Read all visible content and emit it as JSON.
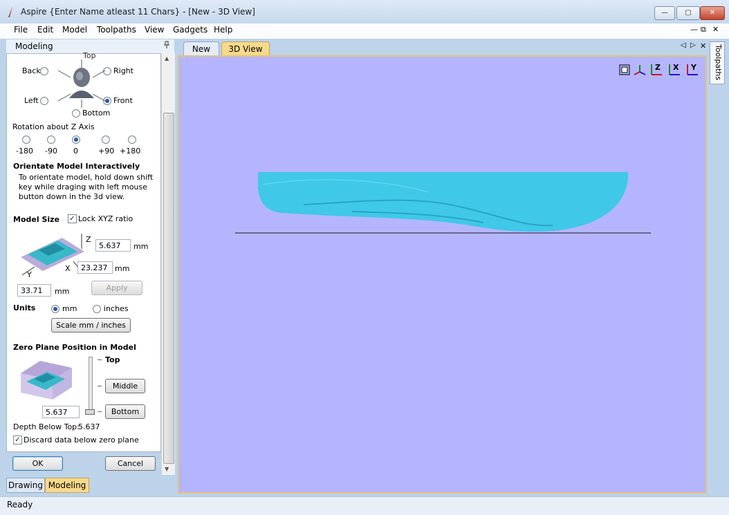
{
  "window": {
    "title": "Aspire {Enter Name atleast 11 Chars} - [New - 3D View]"
  },
  "window_controls": {
    "minimize": "—",
    "maximize": "▢",
    "close": "✕"
  },
  "mdi_controls": {
    "minimize": "—",
    "restore": "⧉",
    "close": "✕"
  },
  "menu": [
    "File",
    "Edit",
    "Model",
    "Toolpaths",
    "View",
    "Gadgets",
    "Help"
  ],
  "modeling_panel": {
    "title": "Modeling",
    "pin_icon": "pin-icon",
    "views": {
      "top": "Top",
      "back": "Back",
      "right": "Right",
      "left": "Left",
      "front": "Front",
      "bottom": "Bottom",
      "selected": "Front"
    },
    "rotation": {
      "label": "Rotation about Z Axis",
      "options": [
        "-180",
        "-90",
        "0",
        "+90",
        "+180"
      ],
      "selected": "0"
    },
    "orientate": {
      "heading": "Orientate Model Interactively",
      "line1": "To orientate model, hold down shift",
      "line2": "key while draging with left mouse",
      "line3": "button down in the  3d view."
    },
    "model_size": {
      "heading": "Model Size",
      "lock_label": "Lock XYZ ratio",
      "lock_checked": true,
      "z_label": "Z",
      "z_value": "5.637",
      "z_unit": "mm",
      "x_label": "X",
      "x_value": "23.237",
      "x_unit": "mm",
      "y_label": "Y",
      "y_value": "33.71",
      "y_unit": "mm",
      "apply_label": "Apply"
    },
    "units": {
      "heading": "Units",
      "mm_label": "mm",
      "inches_label": "inches",
      "selected": "mm",
      "scale_button": "Scale mm / inches"
    },
    "zero_plane": {
      "heading": "Zero Plane Position in Model",
      "top_label": "Top",
      "middle_label": "Middle",
      "bottom_label": "Bottom",
      "depth_value": "5.637",
      "depth_label": "Depth Below Top:",
      "depth_readout": "5.637",
      "discard_label": "Discard data below zero plane",
      "discard_checked": true
    },
    "ok_label": "OK",
    "cancel_label": "Cancel"
  },
  "bottom_tabs": [
    "Drawing",
    "Modeling"
  ],
  "document_tabs": [
    "New",
    "3D View"
  ],
  "active_document_tab": "3D View",
  "right_tab": "Toolpaths",
  "view_icons": [
    "zoom-extents-icon",
    "iso-view-icon",
    "top-view-icon",
    "front-view-icon",
    "side-view-icon"
  ],
  "view_icon_letters": {
    "z": "Z",
    "x": "X",
    "y": "Y"
  },
  "status": "Ready",
  "colors": {
    "viewport_bg": "#b5b5ff",
    "model": "#3fc8e8",
    "active_tab": "#f6d98a",
    "selection_border": "#e3c37a"
  }
}
